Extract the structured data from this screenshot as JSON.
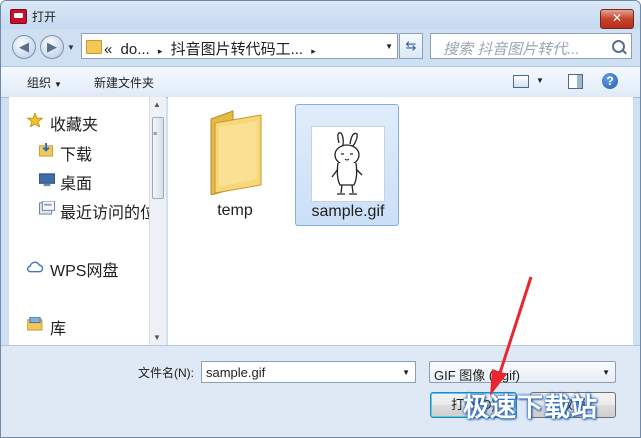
{
  "window": {
    "title": "打开",
    "close_symbol": "✕"
  },
  "nav": {
    "back_symbol": "◀",
    "forward_symbol": "▶",
    "address_parts": [
      "«",
      "do...",
      "▸",
      "抖音图片转代码工...",
      "▸"
    ],
    "refresh_symbol": "⇆",
    "search_placeholder": "搜索 抖音图片转代...",
    "dropdown_symbol": "▼"
  },
  "toolbar": {
    "organize": "组织",
    "new_folder": "新建文件夹",
    "help": "?"
  },
  "sidebar": {
    "items": [
      {
        "label": "收藏夹",
        "icon": "star-icon"
      },
      {
        "label": "下载",
        "icon": "download-folder-icon"
      },
      {
        "label": "桌面",
        "icon": "desktop-icon"
      },
      {
        "label": "最近访问的位置",
        "icon": "recent-places-icon"
      },
      {
        "label": "WPS网盘",
        "icon": "cloud-icon"
      },
      {
        "label": "库",
        "icon": "library-icon"
      }
    ]
  },
  "files": [
    {
      "name": "temp",
      "type": "folder",
      "selected": false
    },
    {
      "name": "sample.gif",
      "type": "image",
      "selected": true
    }
  ],
  "bottom": {
    "filename_label": "文件名(N):",
    "filename_value": "sample.gif",
    "filetype_value": "GIF 图像 (*.gif)",
    "open_button": "打开(O)",
    "cancel_button": "取消"
  },
  "watermark": "极速下载站",
  "colors": {
    "selection": "#cbdff7",
    "accent": "#3c7fb1",
    "arrow": "#e8262d"
  }
}
